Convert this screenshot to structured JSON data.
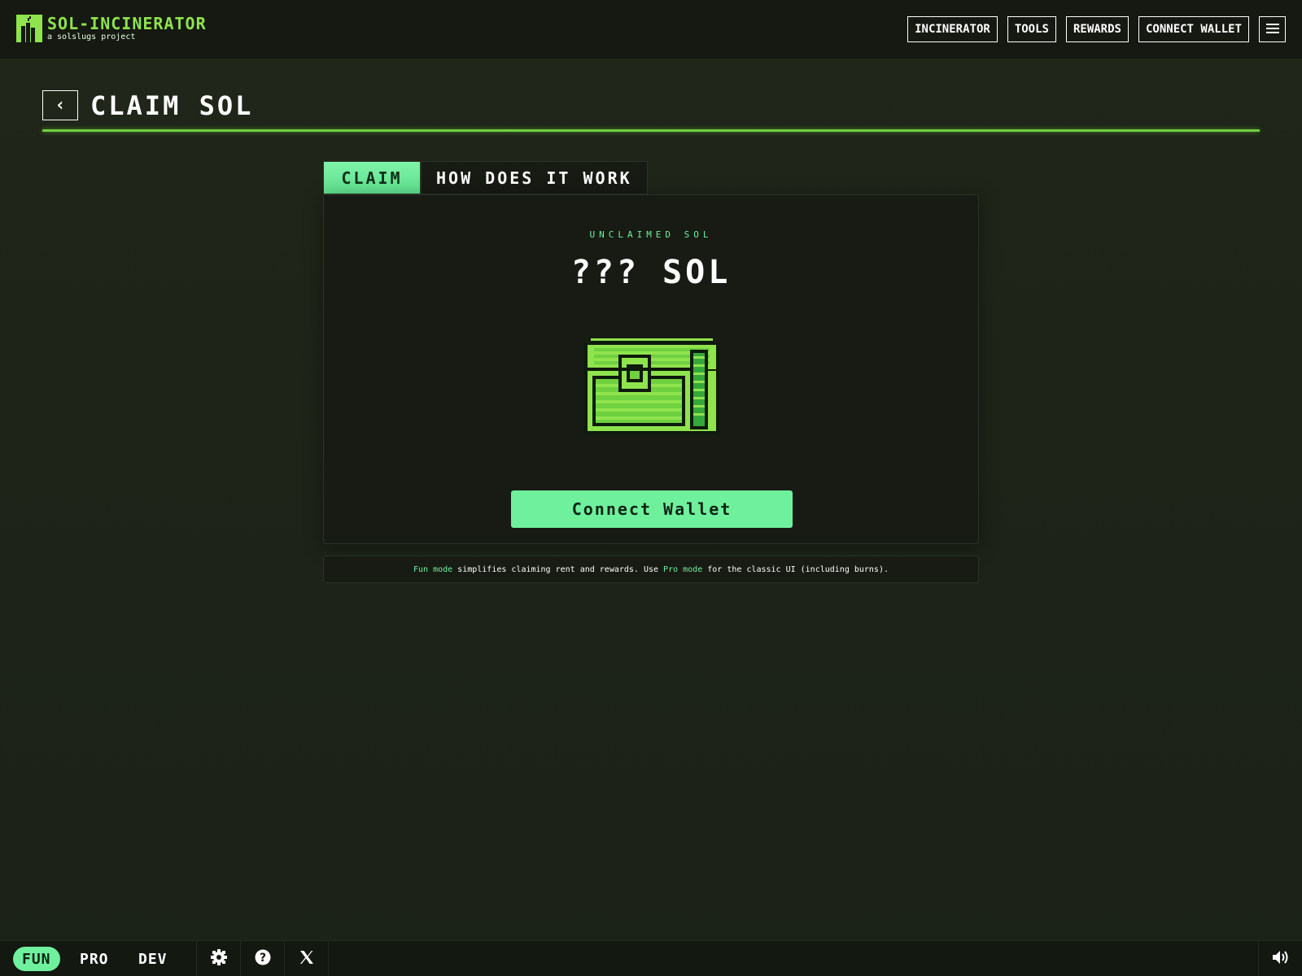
{
  "header": {
    "brand_title": "SOL-INCINERATOR",
    "brand_subtitle": "a solslugs project",
    "nav": {
      "incinerator": "INCINERATOR",
      "tools": "TOOLS",
      "rewards": "REWARDS",
      "connect_wallet": "CONNECT WALLET",
      "menu_icon": "hamburger-icon"
    }
  },
  "page": {
    "back_icon": "chevron-left-icon",
    "back_glyph": "‹",
    "title": "CLAIM SOL"
  },
  "tabs": [
    {
      "label": "CLAIM",
      "active": true
    },
    {
      "label": "HOW DOES IT WORK",
      "active": false
    }
  ],
  "card": {
    "eyebrow": "UNCLAIMED SOL",
    "amount": "??? SOL",
    "image_icon": "treasure-chest-icon",
    "cta_label": "Connect Wallet"
  },
  "note": {
    "fun_mode": "Fun mode",
    "middle": " simplifies claiming rent and rewards. Use ",
    "pro_mode": "Pro mode",
    "end": " for the classic UI (including burns)."
  },
  "footer": {
    "modes": [
      "FUN",
      "PRO",
      "DEV"
    ],
    "active_mode": "FUN",
    "icons": [
      "settings-icon",
      "help-icon",
      "x-twitter-icon",
      "volume-icon"
    ]
  },
  "colors": {
    "accent": "#6ff09d",
    "brand_green": "#8fe34d",
    "rule": "#6fd040",
    "background": "#1e2419",
    "topbar": "#151912"
  }
}
